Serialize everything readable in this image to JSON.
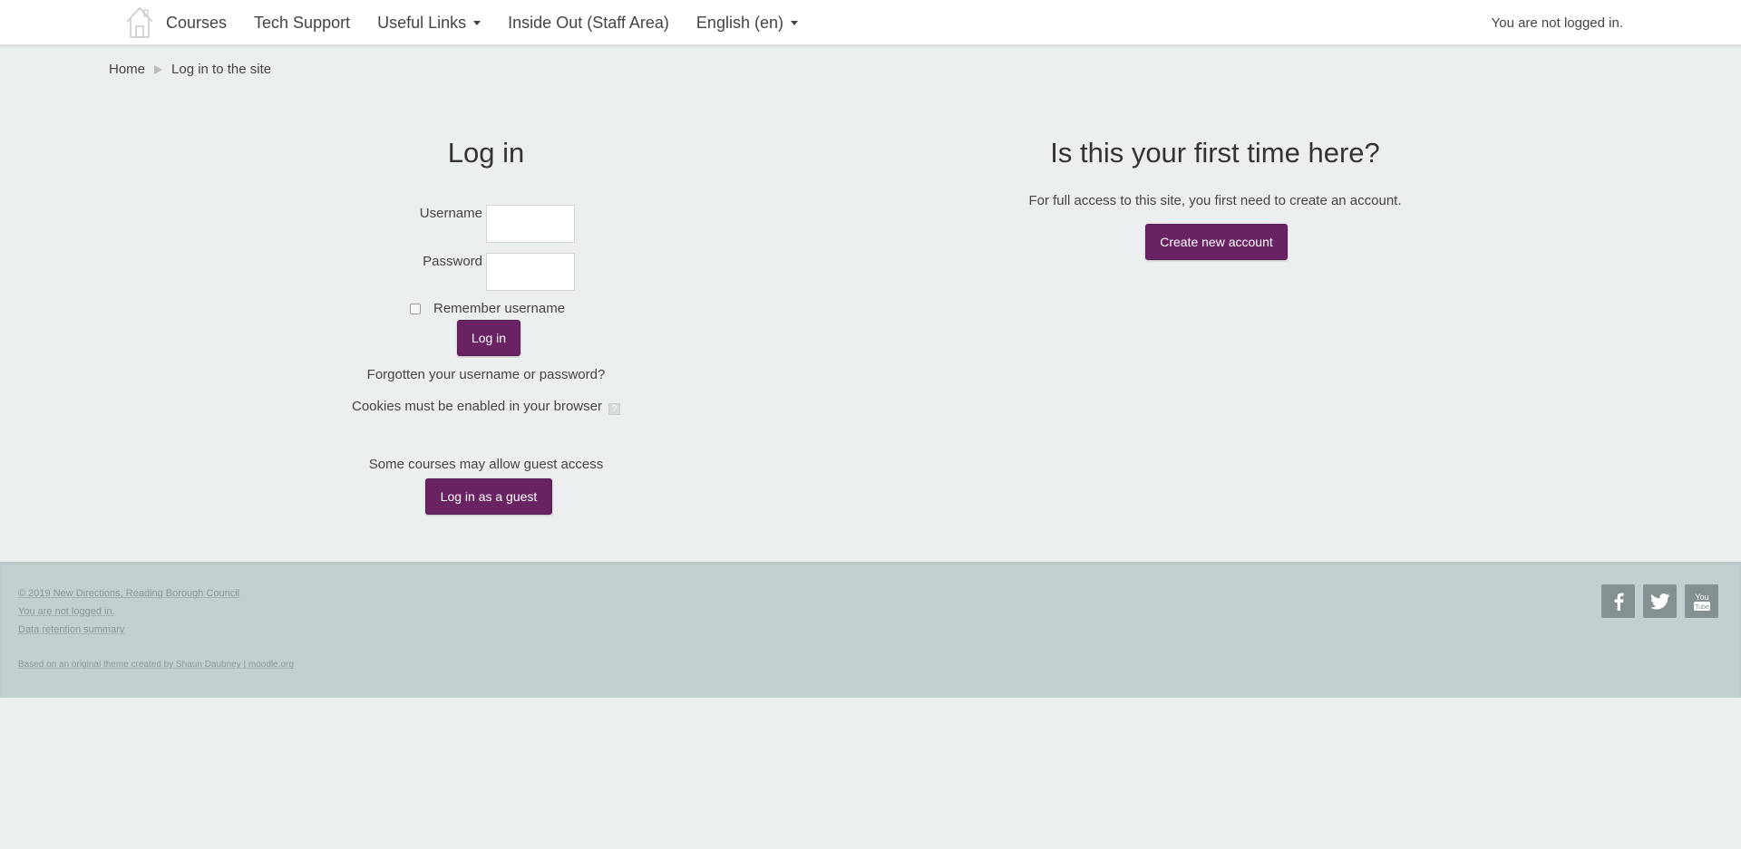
{
  "navbar": {
    "home_icon": "home-icon",
    "items": [
      {
        "label": "Courses",
        "has_caret": false
      },
      {
        "label": "Tech Support",
        "has_caret": false
      },
      {
        "label": "Useful Links",
        "has_caret": true
      },
      {
        "label": "Inside Out (Staff Area)",
        "has_caret": false
      },
      {
        "label": "English (en)",
        "has_caret": true
      }
    ],
    "login_status": "You are not logged in."
  },
  "breadcrumb": {
    "items": [
      "Home",
      "Log in to the site"
    ]
  },
  "login": {
    "title": "Log in",
    "username_label": "Username",
    "username_value": "",
    "password_label": "Password",
    "password_value": "",
    "remember_label": "Remember username",
    "remember_checked": false,
    "submit_label": "Log in",
    "forgot_link": "Forgotten your username or password?",
    "cookies_text": "Cookies must be enabled in your browser",
    "cookies_help_icon": "?",
    "guest_text": "Some courses may allow guest access",
    "guest_button": "Log in as a guest"
  },
  "signup": {
    "title": "Is this your first time here?",
    "text": "For full access to this site, you first need to create an account.",
    "button": "Create new account"
  },
  "footer": {
    "copyright": "© 2019 New Directions, Reading Borough Council",
    "login_status": "You are not logged in.",
    "data_retention": "Data retention summary",
    "credit_prefix": "Based on an original theme created by Shaun Daubney |",
    "credit_link": "moodle.org",
    "social": [
      "facebook-icon",
      "twitter-icon",
      "youtube-icon"
    ]
  },
  "colors": {
    "brand_purple": "#692363",
    "page_bg": "#ecefef",
    "footer_bg": "#c2d0d1",
    "social_bg": "#849091"
  }
}
